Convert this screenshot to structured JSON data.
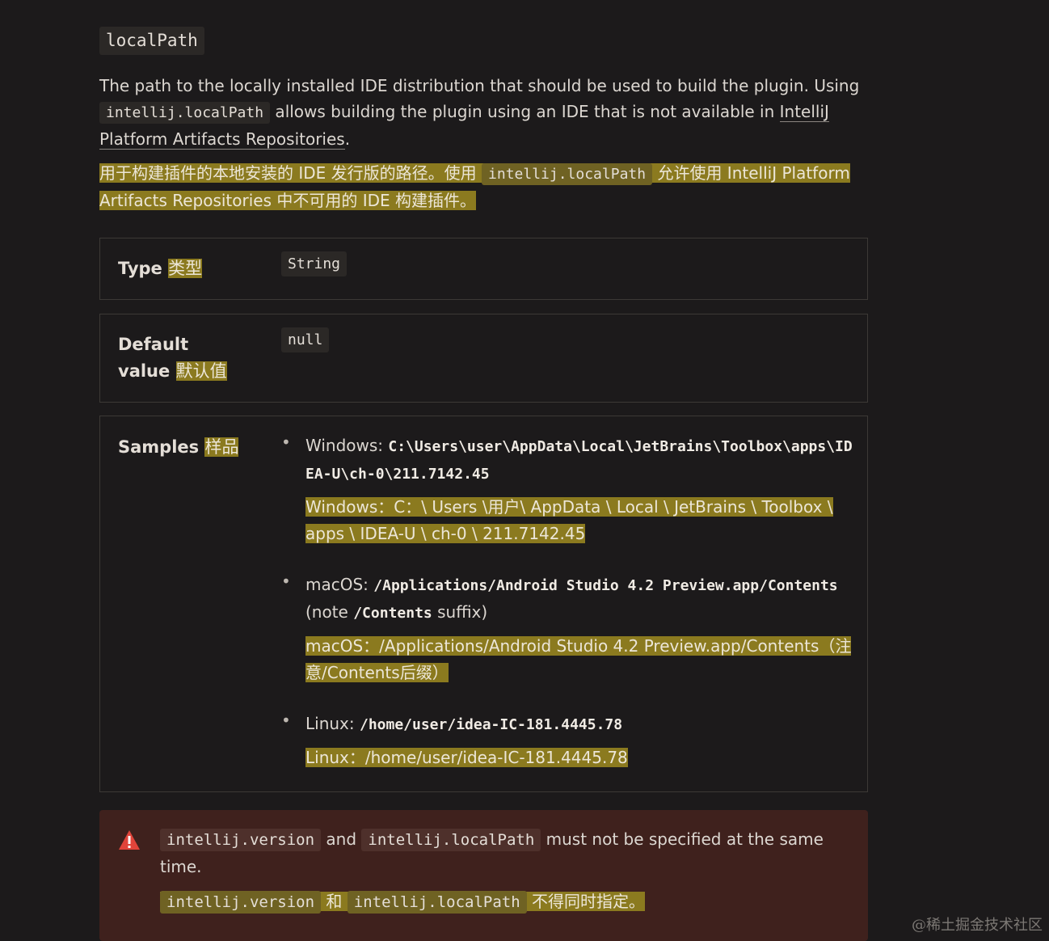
{
  "property_name": "localPath",
  "description": {
    "part1": "The path to the locally installed IDE distribution that should be used to build the plugin. Using ",
    "code": "intellij.localPath",
    "part2": " allows building the plugin using an IDE that is not available in ",
    "link": "IntelliJ Platform Artifacts Repositories",
    "part3": "."
  },
  "description_zh": {
    "part1": "用于构建插件的本地安装的 IDE 发行版的路径。使用 ",
    "code": "intellij.localPath",
    "part2": " 允许使用 IntelliJ Platform Artifacts Repositories 中不可用的 IDE 构建插件。"
  },
  "type_row": {
    "label": "Type",
    "label_zh": "类型",
    "value": "String"
  },
  "default_row": {
    "label_line1": "Default",
    "label_line2": "value",
    "label_zh": "默认值",
    "value": "null"
  },
  "samples": {
    "label": "Samples",
    "label_zh": "样品",
    "items": [
      {
        "prefix": "Windows: ",
        "code": "C:\\Users\\user\\AppData\\Local\\JetBrains\\Toolbox\\apps\\IDEA-U\\ch-0\\211.7142.45",
        "zh": "Windows：C：\\ Users \\用户\\ AppData \\ Local \\ JetBrains \\ Toolbox \\ apps \\ IDEA-U \\ ch-0 \\ 211.7142.45"
      },
      {
        "prefix": "macOS: ",
        "code": "/Applications/Android Studio 4.2 Preview.app/Contents",
        "note_open": " (note ",
        "note_code": "/Contents",
        "note_close": " suffix)",
        "zh": "macOS：/Applications/Android Studio 4.2 Preview.app/Contents（注意/Contents后缀）"
      },
      {
        "prefix": "Linux: ",
        "code": "/home/user/idea-IC-181.4445.78",
        "zh": "Linux：/home/user/idea-IC-181.4445.78"
      }
    ]
  },
  "alert": {
    "code1": "intellij.version",
    "and": " and ",
    "code2": "intellij.localPath",
    "text": " must not be specified at the same time.",
    "zh_code1": "intellij.version",
    "zh_and": " 和 ",
    "zh_code2": "intellij.localPath",
    "zh_text": " 不得同时指定。"
  },
  "watermark": "@稀土掘金技术社区",
  "colors": {
    "background": "#1c1a1b",
    "highlight": "#8b7a1f",
    "alert_bg": "#3f211d",
    "warning_icon": "#e0443a"
  }
}
